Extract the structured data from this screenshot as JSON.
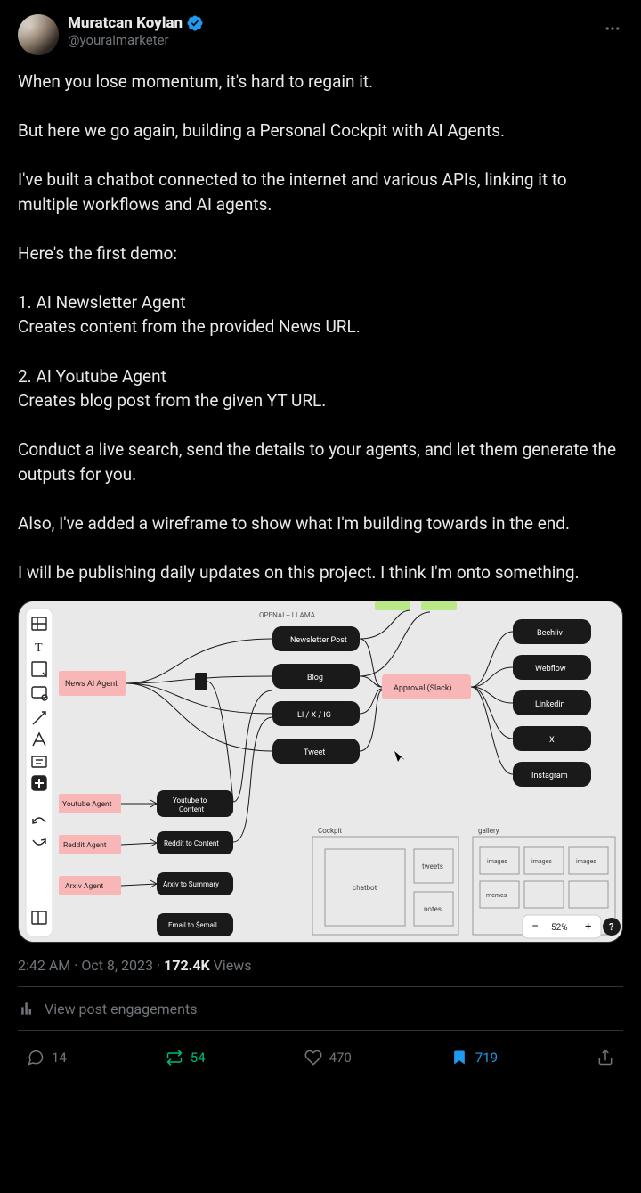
{
  "author": {
    "display_name": "Muratcan Koylan",
    "handle": "@youraimarketer"
  },
  "tweet_text": "When you lose momentum, it's hard to regain it.\n\nBut here we go again, building a Personal Cockpit with AI Agents.\n\nI've built a chatbot connected to the internet and various APIs, linking it to multiple workflows and AI agents.\n\nHere's the first demo:\n\n1. AI Newsletter Agent\nCreates content from the provided News URL.\n\n2. AI Youtube Agent\nCreates blog post from the given YT URL.\n\nConduct a live search, send the details to your agents, and let them generate the outputs for you.\n\nAlso, I've added a wireframe to show what I'm building towards in the end.\n\nI will be publishing daily updates on this project. I think I'm onto something.",
  "media": {
    "toolbar_icons": [
      "layout",
      "text",
      "sticky",
      "shape",
      "arrow",
      "pen",
      "comment",
      "add",
      "undo",
      "redo",
      "frame"
    ],
    "header_label": "OPENAI + LLAMA",
    "agents": [
      {
        "label": "News AI Agent"
      },
      {
        "label": "Youtube Agent"
      },
      {
        "label": "Reddit Agent"
      },
      {
        "label": "Arxiv Agent"
      }
    ],
    "converters": [
      {
        "label": "Youtube to Content"
      },
      {
        "label": "Reddit to Content"
      },
      {
        "label": "Arxiv to Summary"
      },
      {
        "label": "Email to $email"
      }
    ],
    "outputs": [
      {
        "label": "Newsletter Post"
      },
      {
        "label": "Blog"
      },
      {
        "label": "LI / X / IG"
      },
      {
        "label": "Tweet"
      }
    ],
    "approval": "Approval (Slack)",
    "destinations": [
      {
        "label": "Beehiiv"
      },
      {
        "label": "Webflow"
      },
      {
        "label": "Linkedin"
      },
      {
        "label": "X"
      },
      {
        "label": "Instagram"
      }
    ],
    "wireframe_left": {
      "title": "Cockpit",
      "boxes": [
        "chatbot",
        "tweets",
        "notes"
      ]
    },
    "wireframe_right": {
      "title": "gallery",
      "boxes": [
        "images",
        "images",
        "images",
        "memes"
      ]
    },
    "zoom": "52%"
  },
  "timestamp": "2:42 AM · Oct 8, 2023",
  "views_count": "172.4K",
  "views_label": "Views",
  "engagements_label": "View post engagements",
  "actions": {
    "replies": "14",
    "retweets": "54",
    "likes": "470",
    "bookmarks": "719"
  }
}
